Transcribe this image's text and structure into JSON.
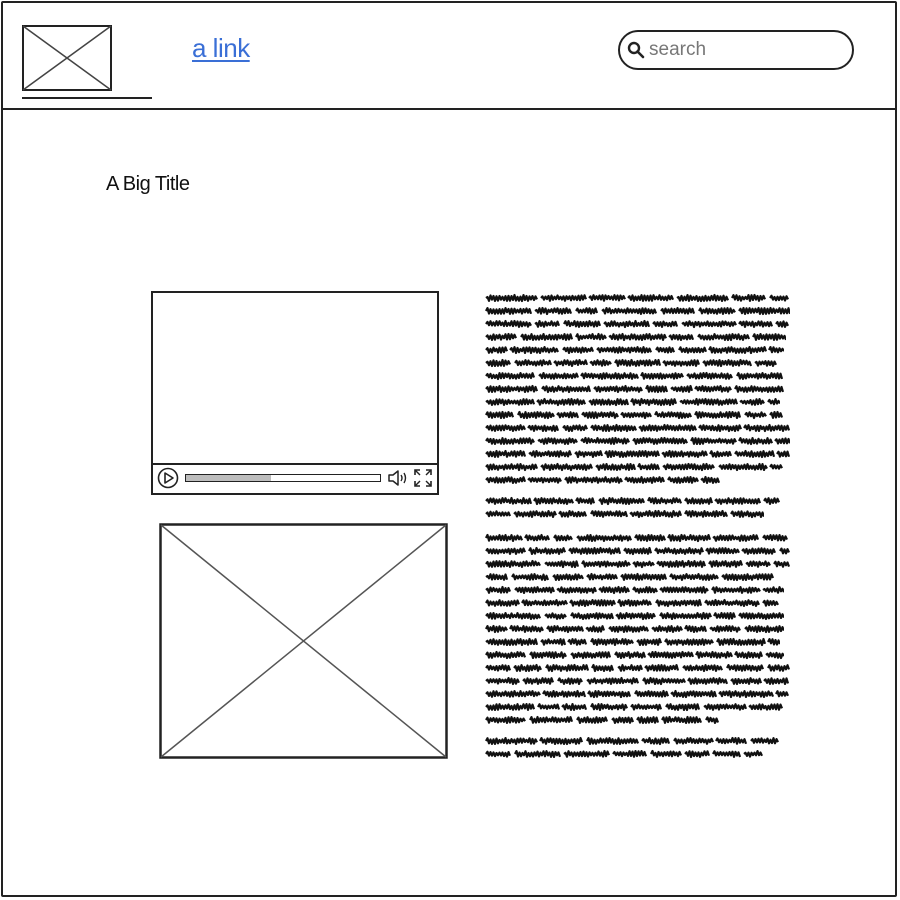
{
  "header": {
    "logo": {
      "icon": "image-placeholder-icon"
    },
    "nav_link": "a link",
    "search": {
      "placeholder": "search",
      "icon": "search-icon"
    }
  },
  "main": {
    "title": "A Big Title",
    "video": {
      "icons": [
        "play-icon",
        "volume-icon",
        "fullscreen-icon"
      ],
      "progress": 0.44
    },
    "image": {
      "icon": "image-placeholder-icon"
    }
  },
  "colors": {
    "stroke": "#222222",
    "link": "#3a6fd6",
    "progress_fill": "#bdbdbd",
    "background": "#ffffff"
  }
}
